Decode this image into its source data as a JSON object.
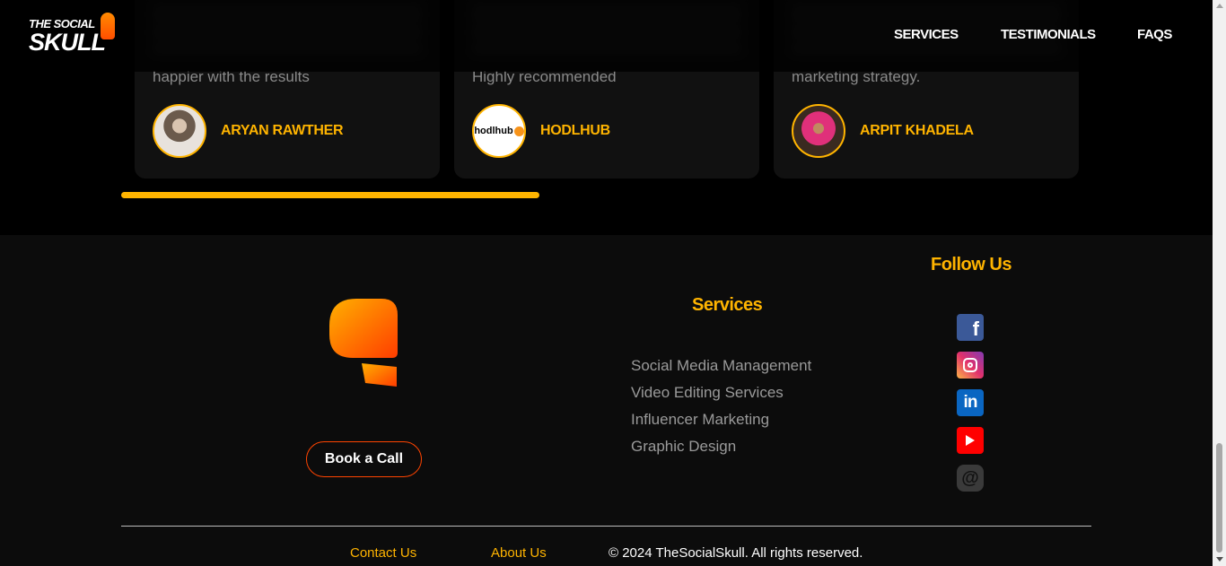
{
  "header": {
    "logo_line1": "THE SOCIAL",
    "logo_line2": "SKULL",
    "nav": [
      "SERVICES",
      "TESTIMONIALS",
      "FAQS"
    ]
  },
  "testimonials": [
    {
      "quote_tail": "happier with the results",
      "name": "ARYAN RAWTHER"
    },
    {
      "quote_tail": "Highly recommended",
      "name": "HODLHUB",
      "avatar_text": "hodlhub"
    },
    {
      "quote_tail": "marketing strategy.",
      "name": "ARPIT KHADELA"
    }
  ],
  "carousel_progress": 0.44,
  "footer": {
    "book_call": "Book a Call",
    "services_title": "Services",
    "services": [
      "Social Media Management",
      "Video Editing Services",
      "Influencer Marketing",
      "Graphic Design"
    ],
    "follow_title": "Follow Us",
    "social_icons": [
      "facebook-icon",
      "instagram-icon",
      "linkedin-icon",
      "youtube-icon",
      "threads-icon"
    ],
    "links": [
      "Contact Us",
      "About Us"
    ],
    "copyright": "© 2024 TheSocialSkull. All rights reserved."
  },
  "colors": {
    "accent": "#ffb400",
    "brand_orange": "#ff6a00",
    "background": "#000000",
    "footer_bg": "#0c0c0c"
  }
}
